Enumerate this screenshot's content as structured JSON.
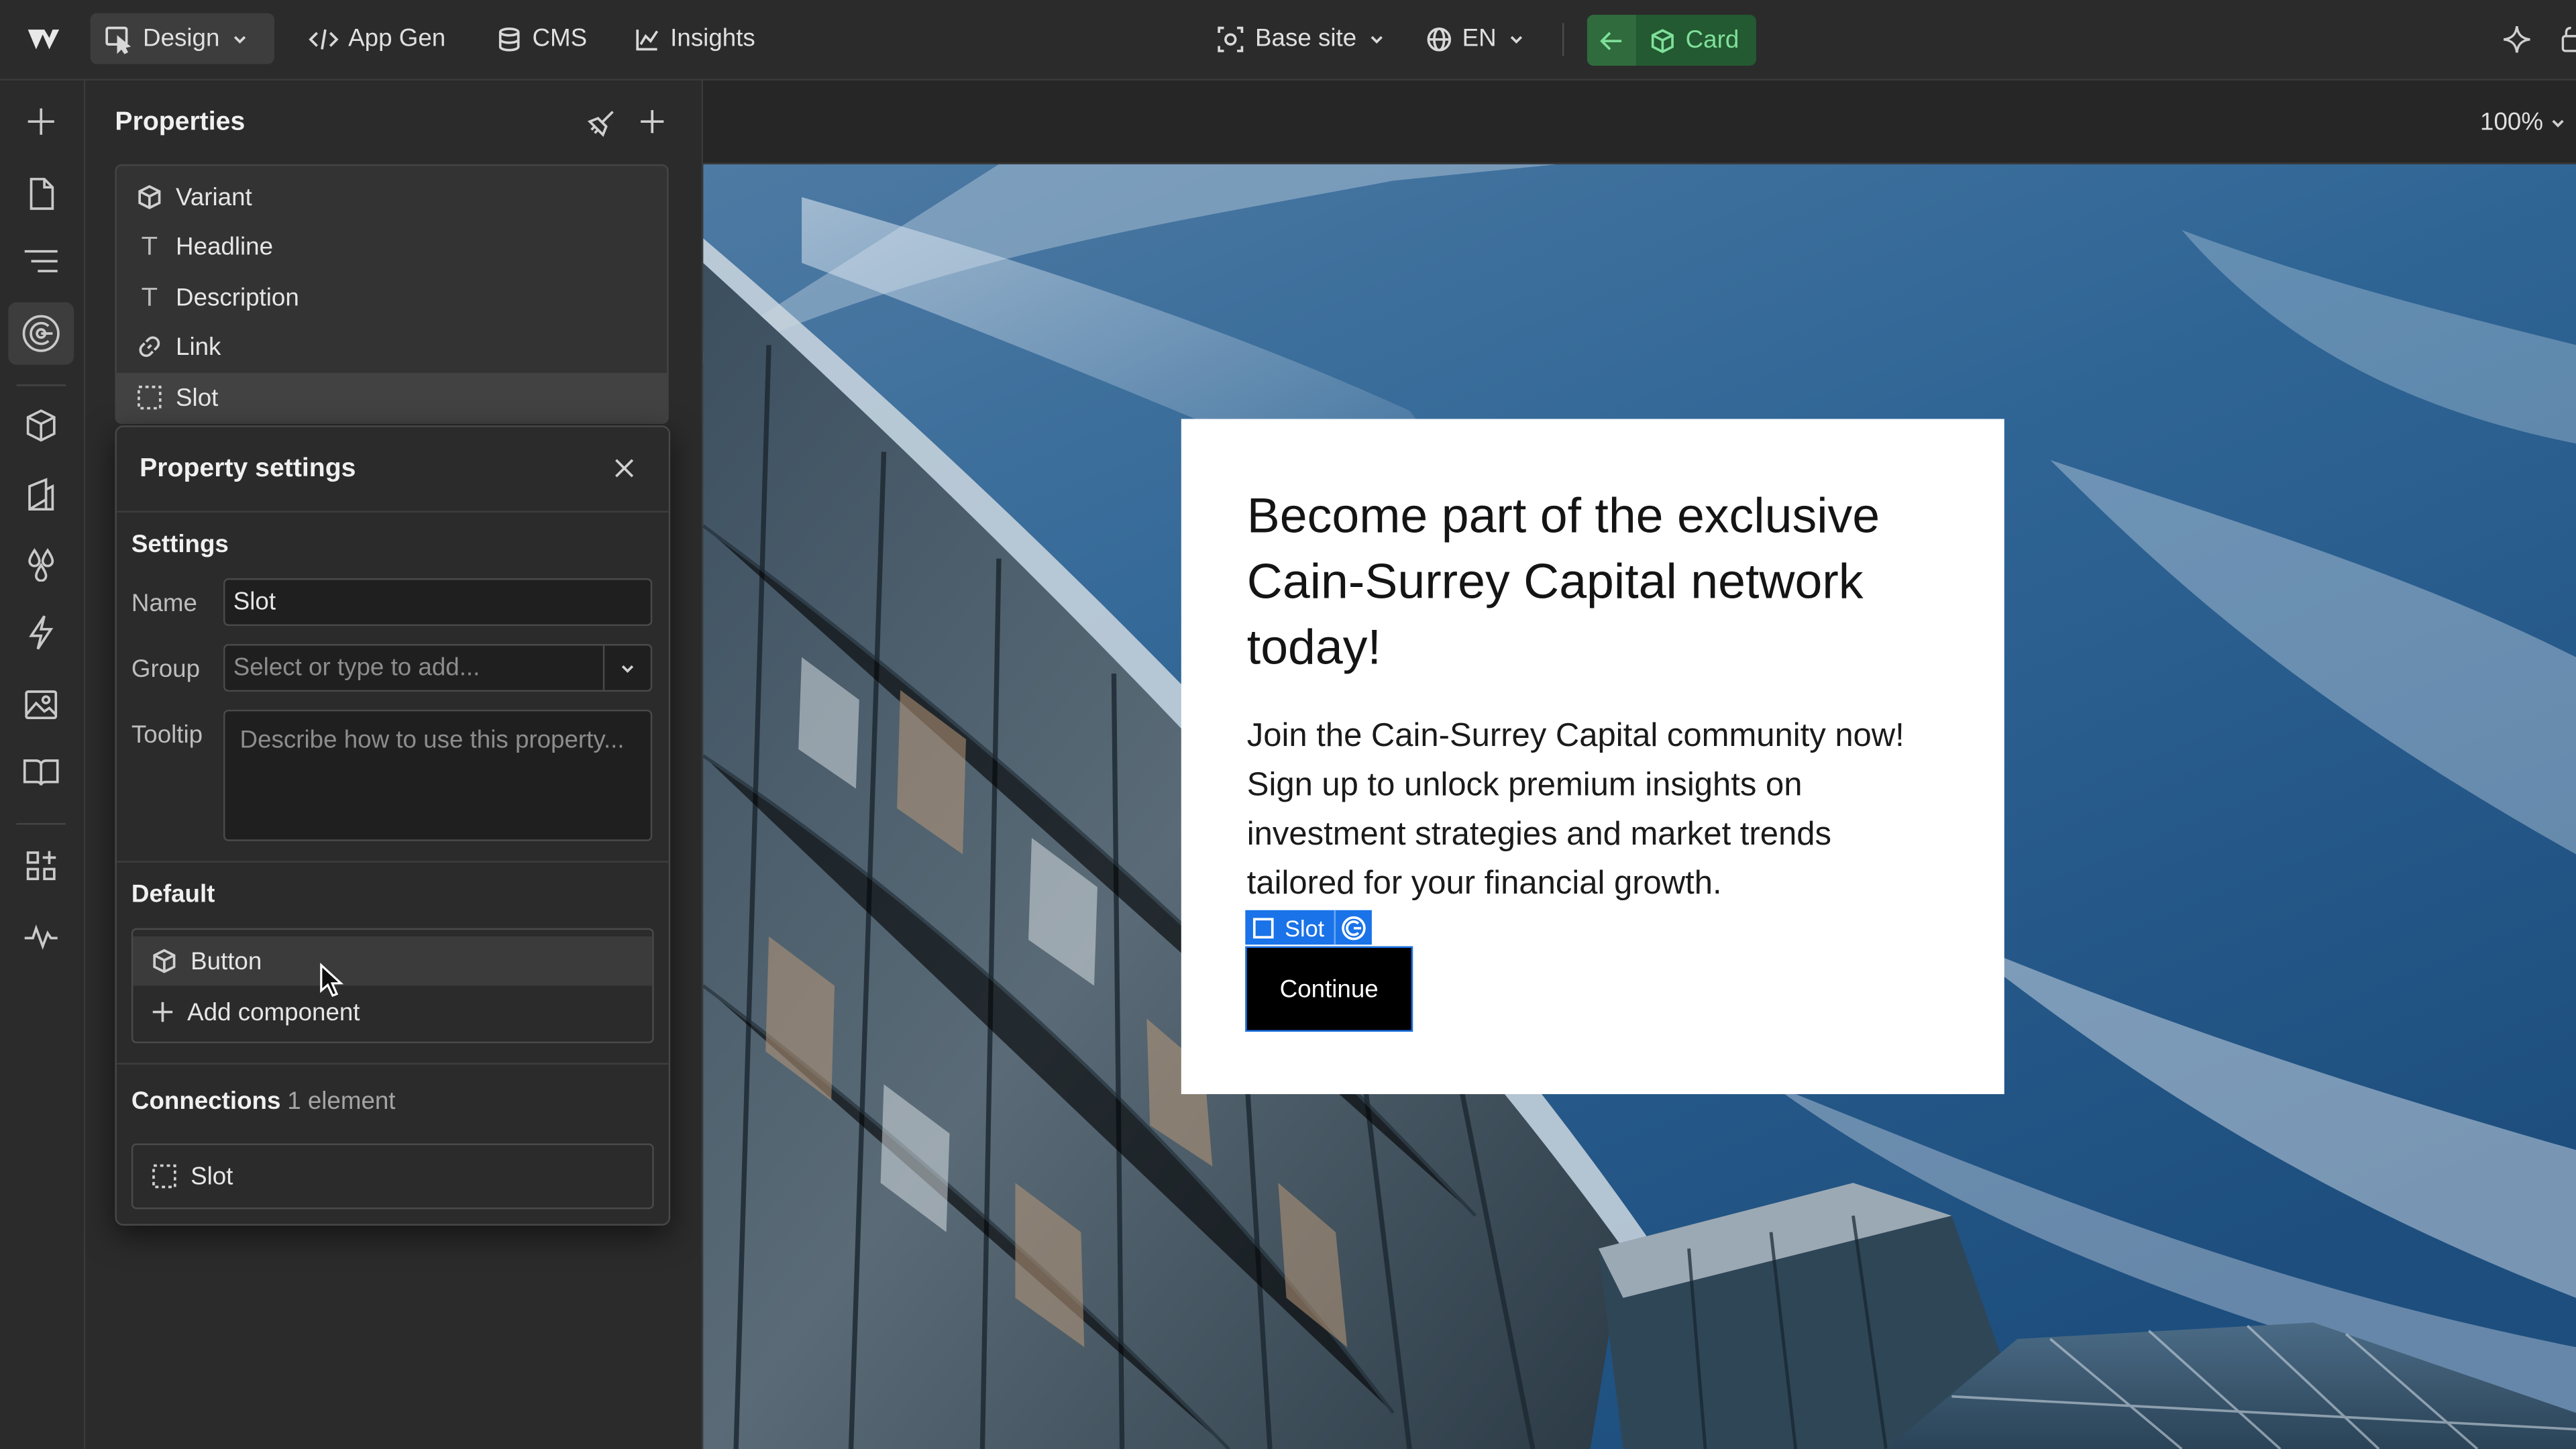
{
  "topbar": {
    "mode_label": "Design",
    "tabs": [
      {
        "label": "App Gen"
      },
      {
        "label": "CMS"
      },
      {
        "label": "Insights"
      }
    ],
    "site_label": "Base site",
    "language_label": "EN",
    "component_label": "Card"
  },
  "properties_panel": {
    "title": "Properties",
    "items": [
      {
        "label": "Variant",
        "icon": "cube-icon"
      },
      {
        "label": "Headline",
        "icon": "text-icon"
      },
      {
        "label": "Description",
        "icon": "text-icon"
      },
      {
        "label": "Link",
        "icon": "link-icon"
      },
      {
        "label": "Slot",
        "icon": "slot-icon",
        "selected": true
      }
    ]
  },
  "property_settings": {
    "title": "Property settings",
    "settings_heading": "Settings",
    "name_label": "Name",
    "name_value": "Slot",
    "group_label": "Group",
    "group_placeholder": "Select or type to add...",
    "tooltip_label": "Tooltip",
    "tooltip_placeholder": "Describe how to use this property...",
    "default_heading": "Default",
    "default_component": "Button",
    "add_component_label": "Add component",
    "connections_heading": "Connections",
    "connections_count": "1 element",
    "connection_item": "Slot"
  },
  "canvas": {
    "zoom": "100%",
    "card": {
      "headline": "Become part of the exclusive Cain-Surrey Capital network today!",
      "description": "Join the Cain-Surrey Capital community now! Sign up to unlock premium insights on investment strategies and market trends tailored for your financial growth.",
      "slot_tag": "Slot",
      "button_label": "Continue"
    }
  },
  "colors": {
    "accent_green": "#7fe09a",
    "selection_blue": "#1a73e8",
    "panel_bg": "#2b2b2b"
  }
}
